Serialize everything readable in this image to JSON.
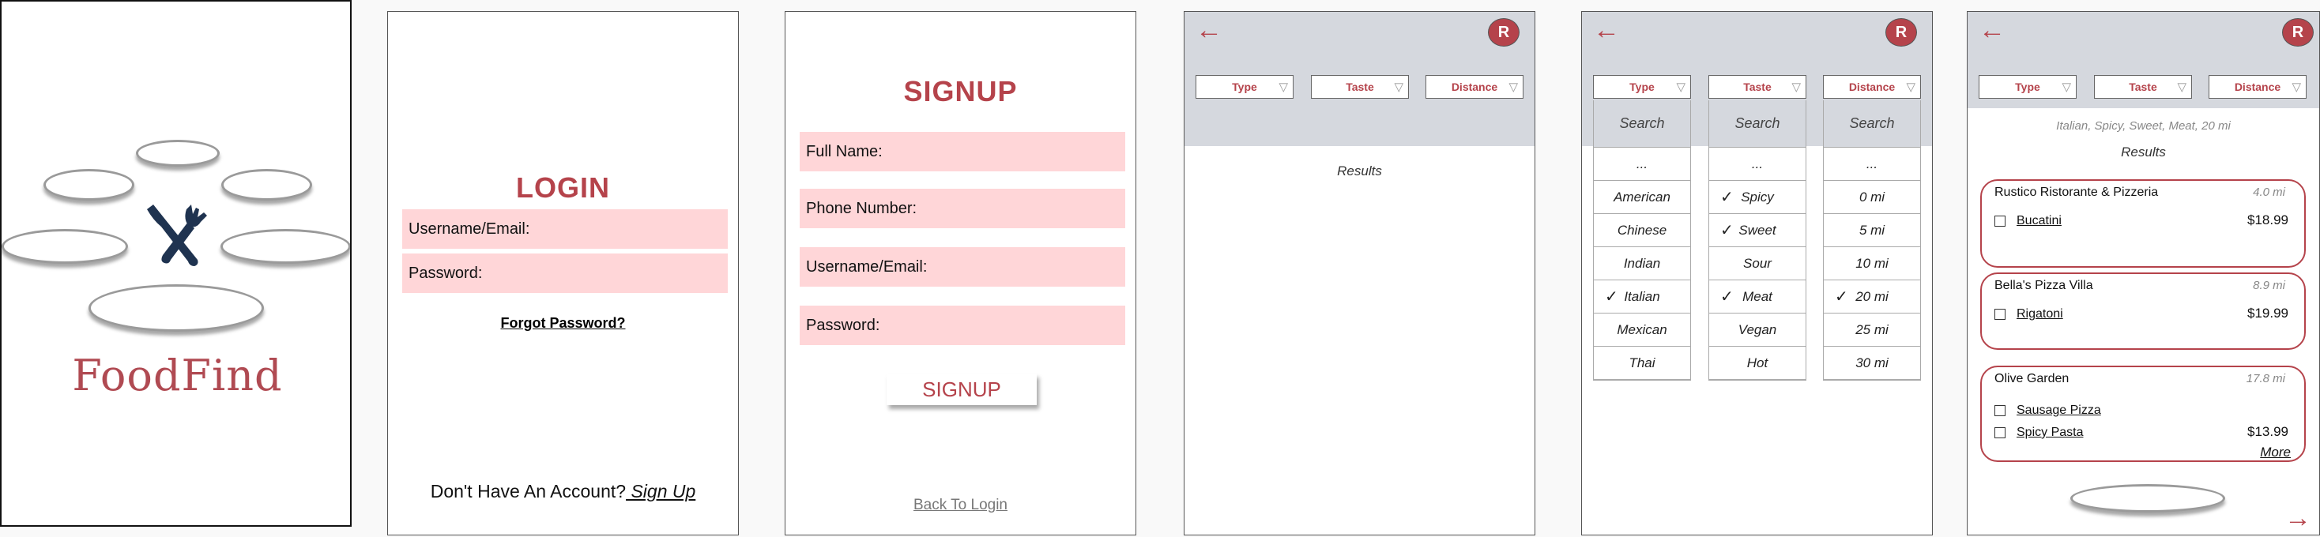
{
  "splash": {
    "app_name": "FoodFind",
    "logo_icon": "crossed-fork-knife-icon",
    "accent": "#b04a52",
    "icon_color": "#1f3350"
  },
  "login": {
    "title": "LOGIN",
    "username_label": "Username/Email:",
    "password_label": "Password:",
    "forgot_link": "Forgot Password?",
    "no_account_text": "Don't Have An Account?",
    "signup_link": " Sign Up"
  },
  "signup": {
    "title": "SIGNUP",
    "fullname_label": "Full Name:",
    "phone_label": "Phone Number:",
    "username_label": "Username/Email:",
    "password_label": "Password:",
    "signup_button": "SIGNUP",
    "back_link": "Back To Login"
  },
  "common": {
    "back_icon": "left-arrow-icon",
    "avatar_initial": "R",
    "filter_type": "Type",
    "filter_taste": "Taste",
    "filter_distance": "Distance",
    "dropdown_icon": "triangle-down-icon",
    "results_label": "Results",
    "accent": "#b5434b",
    "topbar_color": "#d5d8de"
  },
  "filters": {
    "search_placeholder": "Search",
    "ellipsis": "...",
    "type_options": [
      {
        "label": "American",
        "checked": false
      },
      {
        "label": "Chinese",
        "checked": false
      },
      {
        "label": "Indian",
        "checked": false
      },
      {
        "label": "Italian",
        "checked": true
      },
      {
        "label": "Mexican",
        "checked": false
      },
      {
        "label": "Thai",
        "checked": false
      }
    ],
    "taste_options": [
      {
        "label": "Spicy",
        "checked": true
      },
      {
        "label": "Sweet",
        "checked": true
      },
      {
        "label": "Sour",
        "checked": false
      },
      {
        "label": "Meat",
        "checked": true
      },
      {
        "label": "Vegan",
        "checked": false
      },
      {
        "label": "Hot",
        "checked": false
      }
    ],
    "distance_options": [
      {
        "label": "0 mi",
        "checked": false
      },
      {
        "label": "5 mi",
        "checked": false
      },
      {
        "label": "10 mi",
        "checked": false
      },
      {
        "label": "20 mi",
        "checked": true
      },
      {
        "label": "25 mi",
        "checked": false
      },
      {
        "label": "30 mi",
        "checked": false
      }
    ],
    "check_mark": "✓"
  },
  "results": {
    "active_filters": "Italian, Spicy, Sweet, Meat, 20 mi",
    "restaurants": [
      {
        "name": "Rustico Ristorante & Pizzeria",
        "distance": "4.0 mi",
        "items": [
          {
            "name": "Bucatini",
            "price": "$18.99"
          }
        ]
      },
      {
        "name": "Bella's Pizza Villa",
        "distance": "8.9 mi",
        "items": [
          {
            "name": "Rigatoni",
            "price": "$19.99"
          }
        ]
      },
      {
        "name": "Olive Garden",
        "distance": "17.8 mi",
        "items": [
          {
            "name": "Sausage Pizza",
            "price": ""
          },
          {
            "name": "Spicy Pasta",
            "price": "$13.99"
          }
        ]
      }
    ],
    "more_link": "More",
    "next_icon": "right-arrow-icon"
  }
}
